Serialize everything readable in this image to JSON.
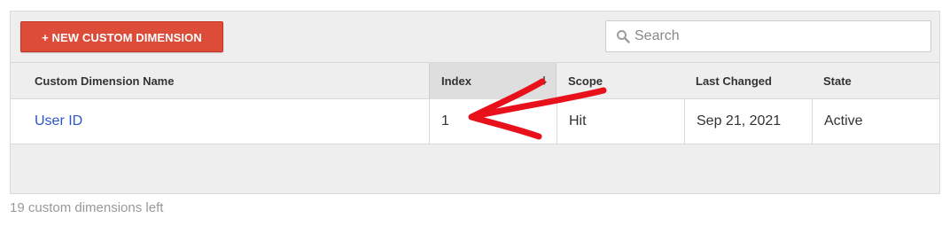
{
  "toolbar": {
    "new_button_label": "+ NEW CUSTOM DIMENSION",
    "search_placeholder": "Search"
  },
  "table": {
    "columns": [
      "Custom Dimension Name",
      "Index",
      "Scope",
      "Last Changed",
      "State"
    ],
    "sorted_column": "Index",
    "rows": [
      {
        "name": "User ID",
        "index": "1",
        "scope": "Hit",
        "last_changed": "Sep 21, 2021",
        "state": "Active"
      }
    ]
  },
  "footer": {
    "remaining_text": "19 custom dimensions left"
  },
  "colors": {
    "primary_button": "#dd4b39",
    "link": "#2a56c6",
    "annotation_arrow": "#e8101a"
  },
  "icons": {
    "search": "search-icon",
    "sort": "sort-descending-icon",
    "annotation": "hand-drawn-arrow-icon"
  }
}
